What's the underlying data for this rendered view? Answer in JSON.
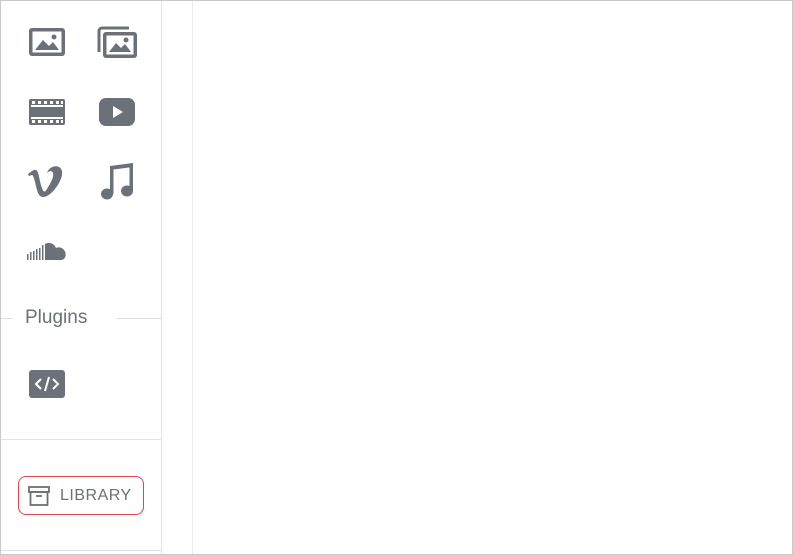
{
  "sidebar": {
    "media_tools": [
      {
        "icon": "image-icon",
        "name": "image"
      },
      {
        "icon": "gallery-icon",
        "name": "gallery"
      },
      {
        "icon": "film-strip-icon",
        "name": "video"
      },
      {
        "icon": "youtube-play-icon",
        "name": "youtube"
      },
      {
        "icon": "vimeo-icon",
        "name": "vimeo"
      },
      {
        "icon": "music-note-icon",
        "name": "audio"
      },
      {
        "icon": "soundcloud-icon",
        "name": "soundcloud"
      }
    ],
    "plugins_label": "Plugins",
    "plugin_tools": [
      {
        "icon": "code-embed-icon",
        "name": "embed-code"
      }
    ],
    "library_label": "LIBRARY"
  },
  "colors": {
    "icon": "#6b7079",
    "library_highlight": "#e0464e",
    "border": "#c9c9c9"
  }
}
